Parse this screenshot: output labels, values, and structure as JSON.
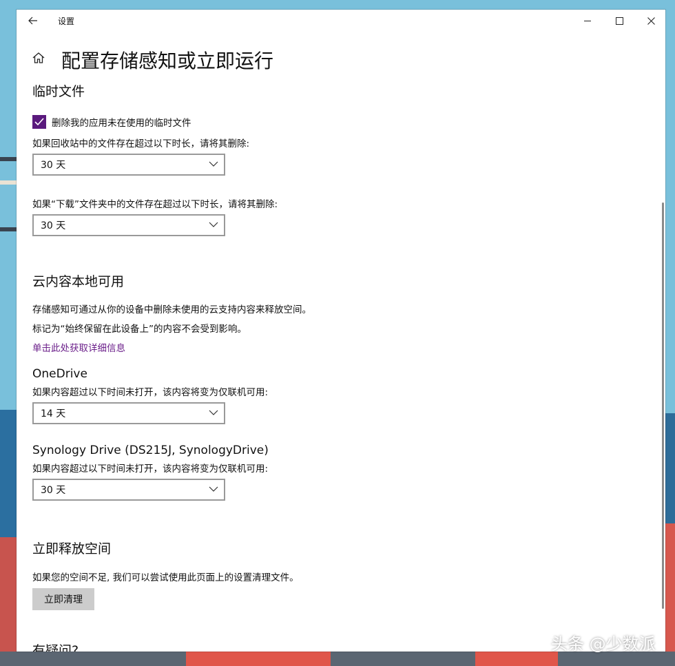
{
  "window": {
    "app_title": "设置",
    "back_icon": "arrow-left-icon",
    "controls": [
      "minimize-icon",
      "maximize-icon",
      "close-icon"
    ]
  },
  "page": {
    "title": "配置存储感知或立即运行",
    "home_icon": "home-icon"
  },
  "temp_files": {
    "heading": "临时文件",
    "checkbox_label": "删除我的应用未在使用的临时文件",
    "checkbox_checked": true,
    "recycle_label": "如果回收站中的文件存在超过以下时长，请将其删除:",
    "recycle_value": "30 天",
    "downloads_label": "如果“下载”文件夹中的文件存在超过以下时长，请将其删除:",
    "downloads_value": "30 天"
  },
  "cloud": {
    "heading": "云内容本地可用",
    "desc1": "存储感知可通过从你的设备中删除未使用的云支持内容来释放空间。",
    "desc2": "标记为“始终保留在此设备上”的内容不会受到影响。",
    "link": "单击此处获取详细信息",
    "onedrive": {
      "name": "OneDrive",
      "label": "如果内容超过以下时间未打开，该内容将变为仅联机可用:",
      "value": "14 天"
    },
    "synology": {
      "name": "Synology Drive (DS215J, SynologyDrive)",
      "label": "如果内容超过以下时间未打开，该内容将变为仅联机可用:",
      "value": "30 天"
    }
  },
  "free_space": {
    "heading": "立即释放空间",
    "desc": "如果您的空间不足, 我们可以尝试使用此页面上的设置清理文件。",
    "button": "立即清理"
  },
  "questions": {
    "heading": "有疑问?"
  },
  "watermark": "头条 @少数派",
  "colors": {
    "accent": "#5a1a7d",
    "link": "#6b1f8a",
    "button_bg": "#cccccc"
  }
}
